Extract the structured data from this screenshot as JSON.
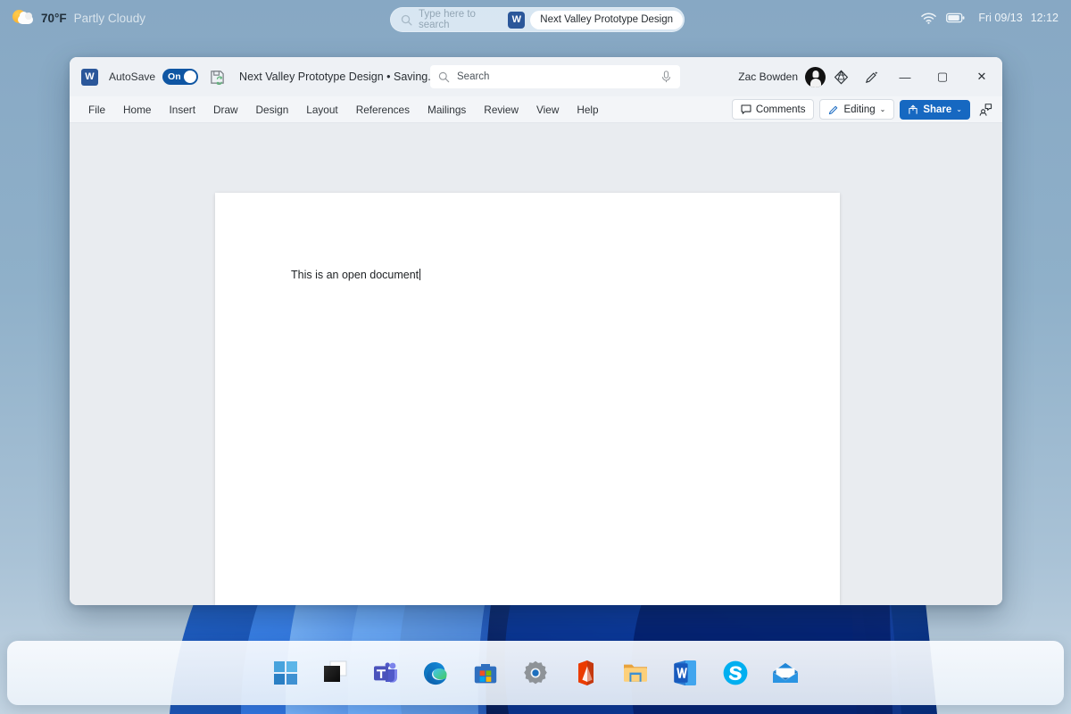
{
  "desktop": {
    "weather": {
      "icon": "partly-cloudy-icon",
      "temperature": "70°F",
      "condition": "Partly Cloudy"
    },
    "search": {
      "icon": "search-icon",
      "placeholder": "Type here to search",
      "result_pill": {
        "app_badge": "W",
        "label": "Next Valley Prototype Design"
      }
    },
    "tray": {
      "wifi_icon": "wifi-icon",
      "battery_icon": "battery-icon",
      "date": "Fri 09/13",
      "time": "12:12"
    }
  },
  "word": {
    "titlebar": {
      "app_icon": "W",
      "autosave_label": "AutoSave",
      "autosave_state": "On",
      "save_icon": "save-sync-icon",
      "document_title": "Next Valley Prototype Design • Saving...",
      "title_chevron": "⌄",
      "search_placeholder": "Search",
      "search_icon": "search-icon",
      "mic_icon": "microphone-icon",
      "account_name": "Zac Bowden",
      "avatar_icon": "user-avatar",
      "premium_icon": "diamond-icon",
      "editor_icon": "pen-sparkle-icon",
      "minimize": "—",
      "maximize": "▢",
      "close": "✕"
    },
    "ribbon": {
      "tabs": [
        {
          "label": "File"
        },
        {
          "label": "Home"
        },
        {
          "label": "Insert"
        },
        {
          "label": "Draw"
        },
        {
          "label": "Design"
        },
        {
          "label": "Layout"
        },
        {
          "label": "References"
        },
        {
          "label": "Mailings"
        },
        {
          "label": "Review"
        },
        {
          "label": "View"
        },
        {
          "label": "Help"
        }
      ],
      "comments_label": "Comments",
      "comments_icon": "comment-icon",
      "editing_label": "Editing",
      "editing_icon": "pencil-icon",
      "editing_chevron": "⌄",
      "share_label": "Share",
      "share_icon": "share-icon",
      "share_chevron": "⌄",
      "ribbon_display_icon": "person-share-icon"
    },
    "document": {
      "body_text": "This is an open document"
    }
  },
  "taskbar": {
    "items": [
      {
        "name": "start",
        "icon": "windows-start-icon"
      },
      {
        "name": "task-view",
        "icon": "task-view-icon"
      },
      {
        "name": "microsoft-teams",
        "icon": "teams-icon"
      },
      {
        "name": "microsoft-edge",
        "icon": "edge-icon"
      },
      {
        "name": "microsoft-store",
        "icon": "store-icon"
      },
      {
        "name": "settings",
        "icon": "settings-gear-icon"
      },
      {
        "name": "office",
        "icon": "office-icon"
      },
      {
        "name": "file-explorer",
        "icon": "folder-icon"
      },
      {
        "name": "microsoft-word",
        "icon": "word-icon"
      },
      {
        "name": "skype",
        "icon": "skype-icon"
      },
      {
        "name": "mail",
        "icon": "mail-icon"
      }
    ]
  },
  "colors": {
    "accent_blue": "#1668c1",
    "word_blue": "#2b579a",
    "toggle_blue": "#0f56a3"
  }
}
